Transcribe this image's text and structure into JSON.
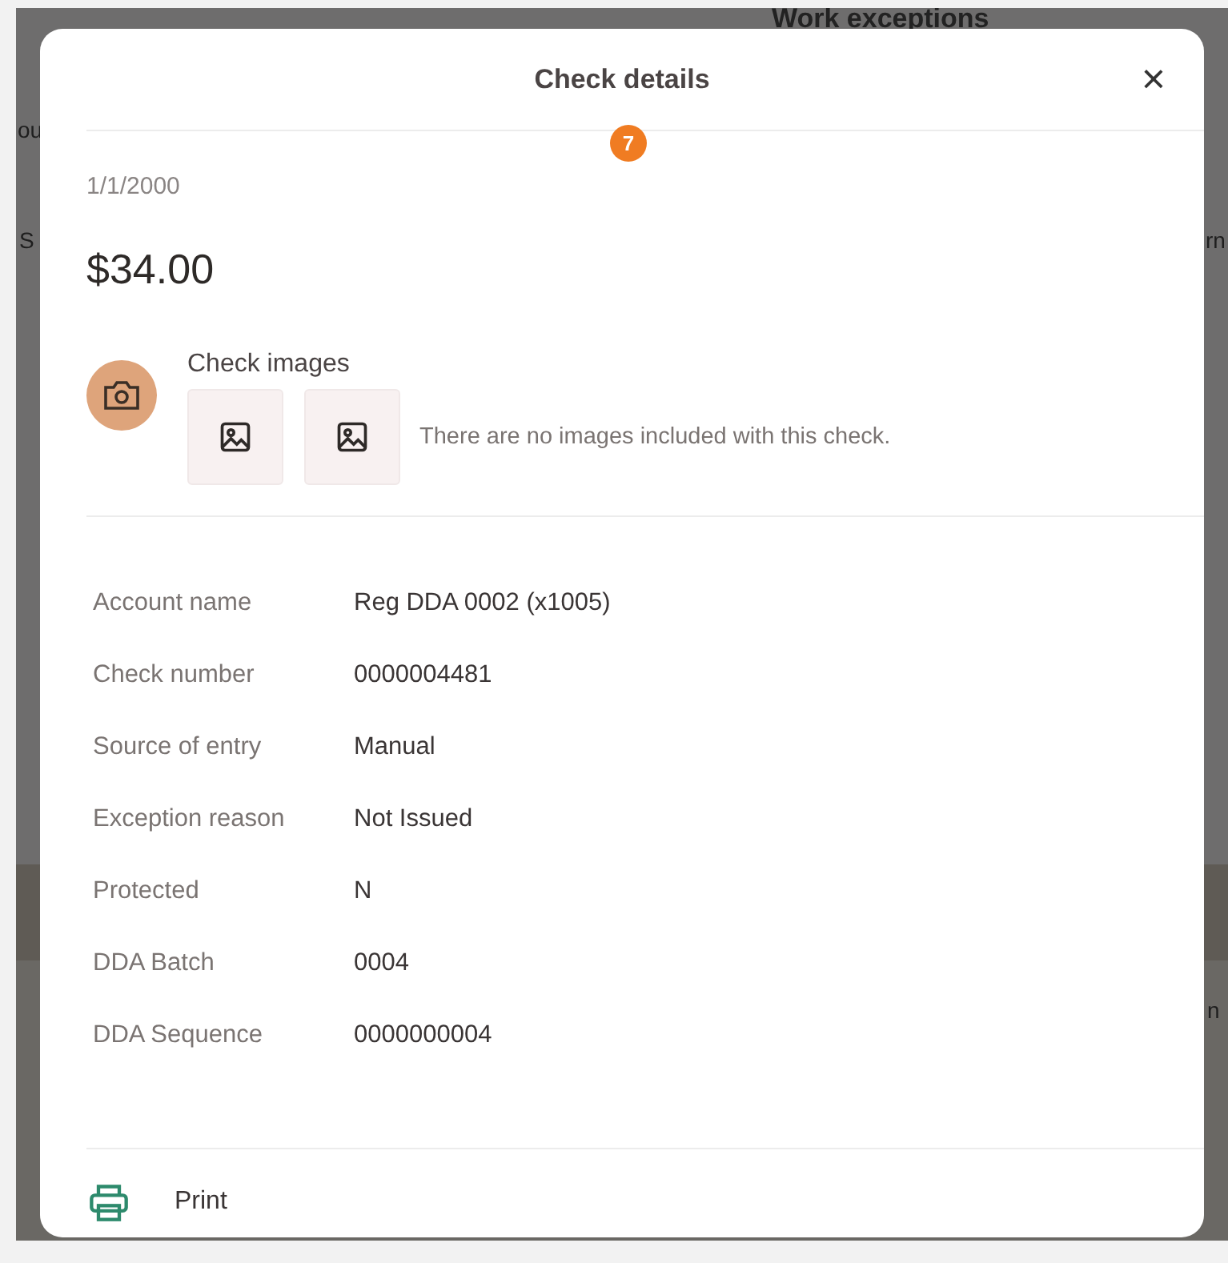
{
  "background_page": {
    "title": "Work exceptions",
    "fragments": [
      {
        "text": "ou",
        "kind": "left"
      },
      {
        "text": "S",
        "kind": "left"
      },
      {
        "text": "rn",
        "kind": "right"
      },
      {
        "text": "n",
        "kind": "right"
      }
    ]
  },
  "dialog": {
    "title": "Check details",
    "close": "×",
    "badge": "7",
    "date": "1/1/2000",
    "amount": "$34.00",
    "images": {
      "heading": "Check images",
      "tiles": [
        {
          "kind": "placeholder"
        },
        {
          "kind": "placeholder"
        }
      ],
      "message": "There are no images included with this check."
    },
    "details": [
      {
        "label": "Account name",
        "value": "Reg DDA 0002 (x1005)"
      },
      {
        "label": "Check number",
        "value": "0000004481"
      },
      {
        "label": "Source of entry",
        "value": "Manual"
      },
      {
        "label": "Exception reason",
        "value": "Not Issued"
      },
      {
        "label": "Protected",
        "value": "N"
      },
      {
        "label": "DDA Batch",
        "value": "0004"
      },
      {
        "label": "DDA Sequence",
        "value": "0000000004"
      }
    ],
    "actions": [
      {
        "kind": "print",
        "label": "Print"
      }
    ]
  }
}
